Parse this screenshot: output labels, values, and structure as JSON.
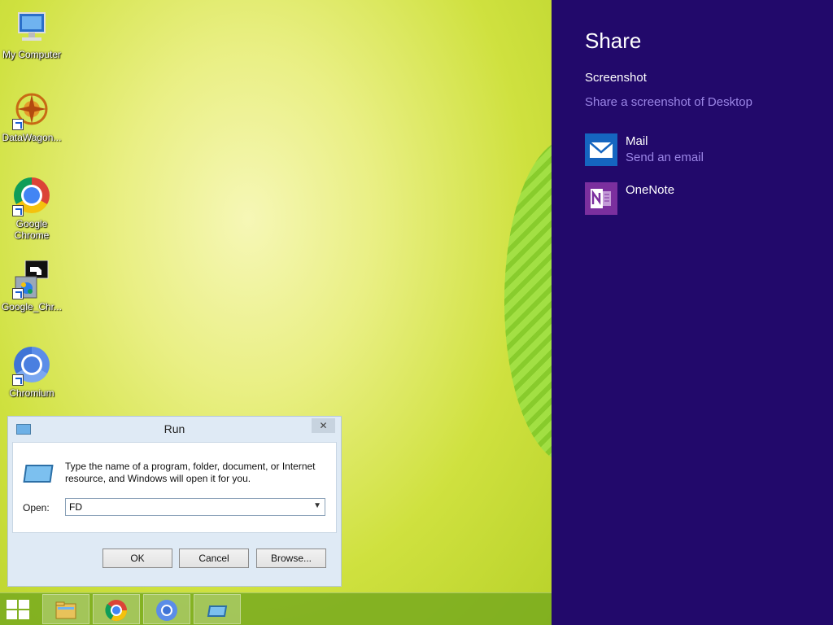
{
  "desktop": {
    "icons": [
      {
        "label": "My Computer"
      },
      {
        "label": "DataWagon..."
      },
      {
        "label": "Google Chrome"
      },
      {
        "label": "Google_Chr..."
      },
      {
        "label": "Chromium"
      }
    ]
  },
  "run_dialog": {
    "title": "Run",
    "close_glyph": "✕",
    "description": "Type the name of a program, folder, document, or Internet resource, and Windows will open it for you.",
    "open_label": "Open:",
    "open_value": "FD",
    "ok_label": "OK",
    "cancel_label": "Cancel",
    "browse_label": "Browse..."
  },
  "share_panel": {
    "title": "Share",
    "subject": "Screenshot",
    "subject_desc": "Share a screenshot of Desktop",
    "apps": [
      {
        "name": "Mail",
        "desc": "Send an email",
        "color": "#1565c0"
      },
      {
        "name": "OneNote",
        "desc": "",
        "color": "#7b2f9e"
      }
    ]
  },
  "colors": {
    "share_bg": "#22096b",
    "accent_text": "#9b86e6"
  }
}
